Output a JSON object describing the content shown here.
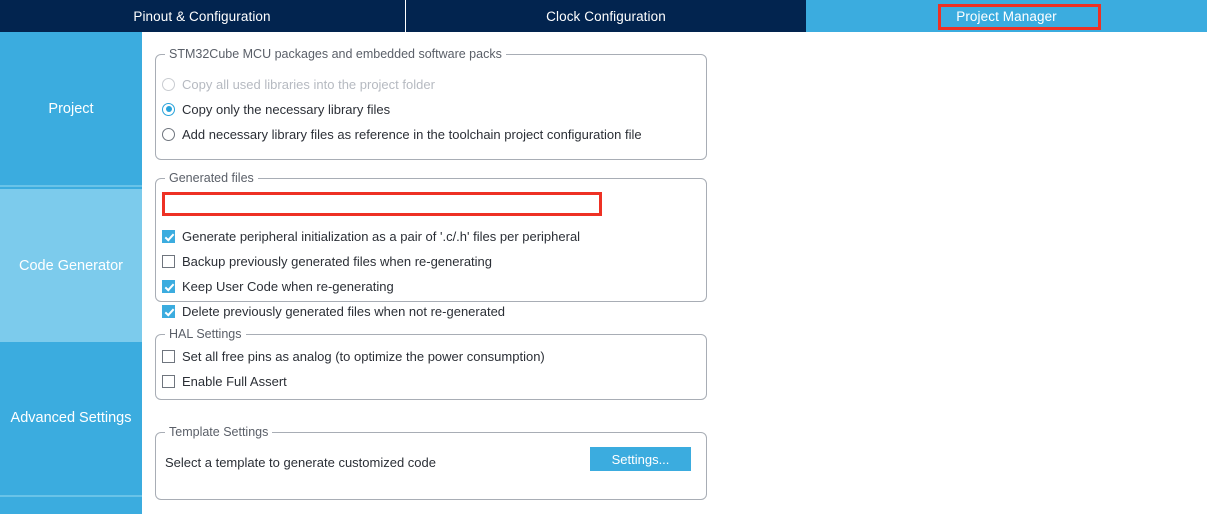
{
  "tabs": [
    {
      "id": "pinout",
      "label": "Pinout & Configuration",
      "selected": false
    },
    {
      "id": "clock",
      "label": "Clock Configuration",
      "selected": false
    },
    {
      "id": "project",
      "label": "Project Manager",
      "selected": true
    }
  ],
  "sidebar": {
    "items": [
      {
        "id": "project",
        "label": "Project",
        "selected": false
      },
      {
        "id": "codegen",
        "label": "Code Generator",
        "selected": true
      },
      {
        "id": "advanced",
        "label": "Advanced Settings",
        "selected": false
      }
    ]
  },
  "groups": {
    "packages": {
      "title": "STM32Cube MCU packages and embedded software packs",
      "options": [
        {
          "label": "Copy all used libraries into the project folder",
          "checked": false,
          "disabled": true
        },
        {
          "label": "Copy only the necessary library files",
          "checked": true,
          "disabled": false
        },
        {
          "label": "Add necessary library files as reference in the toolchain project configuration file",
          "checked": false,
          "disabled": false
        }
      ]
    },
    "generated": {
      "title": "Generated files",
      "options": [
        {
          "label": "Generate peripheral initialization as a pair of '.c/.h' files per peripheral",
          "checked": true,
          "highlighted": true
        },
        {
          "label": "Backup previously generated files when re-generating",
          "checked": false,
          "highlighted": false
        },
        {
          "label": "Keep User Code when re-generating",
          "checked": true,
          "highlighted": false
        },
        {
          "label": "Delete previously generated files when not re-generated",
          "checked": true,
          "highlighted": false
        }
      ]
    },
    "hal": {
      "title": "HAL Settings",
      "options": [
        {
          "label": "Set all free pins as analog (to optimize the power consumption)",
          "checked": false
        },
        {
          "label": "Enable Full Assert",
          "checked": false
        }
      ]
    },
    "template": {
      "title": "Template Settings",
      "description": "Select a template to generate customized code",
      "settings_button": "Settings..."
    }
  },
  "annotations": {
    "tab_highlight": "Project Manager",
    "checkbox_highlight": "Generate peripheral initialization as a pair of '.c/.h' files per peripheral"
  },
  "colors": {
    "tabbar_bg": "#02244f",
    "accent_blue": "#3bacdf",
    "selected_sidebar": "#7ccbec",
    "annotation_red": "#ee3124",
    "group_border": "#a8adb5"
  }
}
